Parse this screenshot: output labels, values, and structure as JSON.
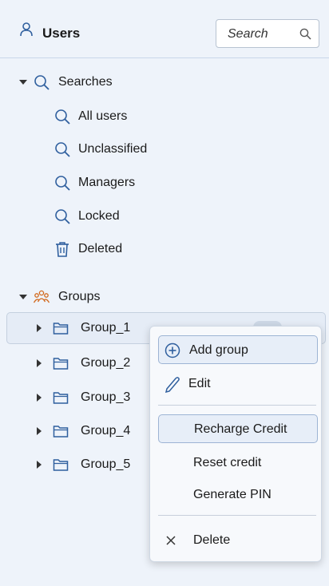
{
  "header": {
    "title": "Users",
    "search_placeholder": "Search",
    "icon": "user-icon"
  },
  "tree": {
    "searches": {
      "label": "Searches",
      "items": [
        {
          "label": "All users",
          "icon": "search-icon"
        },
        {
          "label": "Unclassified",
          "icon": "search-icon"
        },
        {
          "label": "Managers",
          "icon": "search-icon"
        },
        {
          "label": "Locked",
          "icon": "search-icon"
        },
        {
          "label": "Deleted",
          "icon": "trash-icon"
        }
      ]
    },
    "groups": {
      "label": "Groups",
      "items": [
        {
          "label": "Group_1",
          "selected": true
        },
        {
          "label": "Group_2"
        },
        {
          "label": "Group_3"
        },
        {
          "label": "Group_4"
        },
        {
          "label": "Group_5"
        }
      ]
    }
  },
  "context_menu": {
    "items": [
      {
        "label": "Add group",
        "icon": "plus-circle-icon",
        "highlighted": true
      },
      {
        "label": "Edit",
        "icon": "pencil-icon"
      },
      {
        "label": "Recharge Credit",
        "highlighted": true
      },
      {
        "label": "Reset credit"
      },
      {
        "label": "Generate PIN"
      },
      {
        "label": "Delete",
        "icon": "close-icon"
      }
    ]
  },
  "colors": {
    "background": "#eef3fa",
    "accent": "#2f5f9e",
    "highlight": "#e7eef8",
    "highlight_border": "#9db4d4"
  }
}
